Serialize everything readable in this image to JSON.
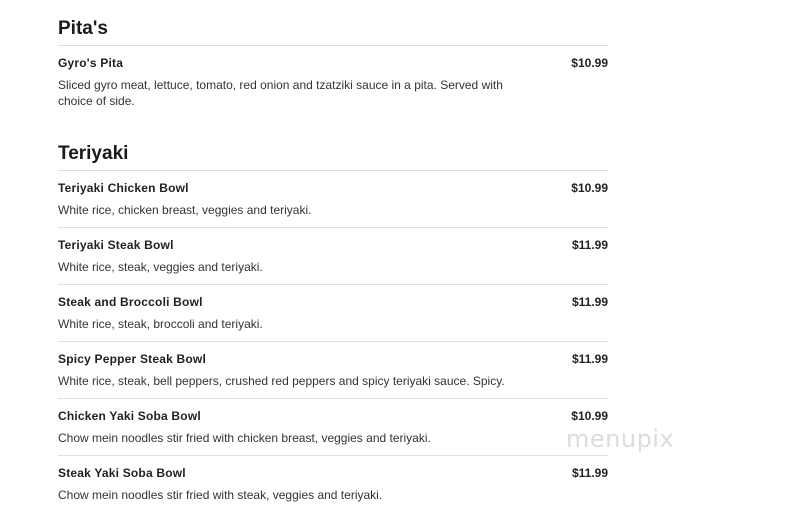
{
  "sections": [
    {
      "title": "Pita's",
      "items": [
        {
          "name": "Gyro's Pita",
          "price": "$10.99",
          "desc": "Sliced gyro meat, lettuce, tomato, red onion and tzatziki sauce in a pita. Served with choice of side."
        }
      ]
    },
    {
      "title": "Teriyaki",
      "items": [
        {
          "name": "Teriyaki Chicken Bowl",
          "price": "$10.99",
          "desc": "White rice, chicken breast, veggies and teriyaki."
        },
        {
          "name": "Teriyaki Steak Bowl",
          "price": "$11.99",
          "desc": "White rice, steak, veggies and teriyaki."
        },
        {
          "name": "Steak and Broccoli Bowl",
          "price": "$11.99",
          "desc": "White rice, steak, broccoli and teriyaki."
        },
        {
          "name": "Spicy Pepper Steak Bowl",
          "price": "$11.99",
          "desc": "White rice, steak, bell peppers, crushed red peppers and spicy teriyaki sauce. Spicy."
        },
        {
          "name": "Chicken Yaki Soba Bowl",
          "price": "$10.99",
          "desc": "Chow mein noodles stir fried with chicken breast, veggies and teriyaki."
        },
        {
          "name": "Steak Yaki Soba Bowl",
          "price": "$11.99",
          "desc": "Chow mein noodles stir fried with steak, veggies and teriyaki."
        }
      ]
    }
  ],
  "watermark": "menupix"
}
